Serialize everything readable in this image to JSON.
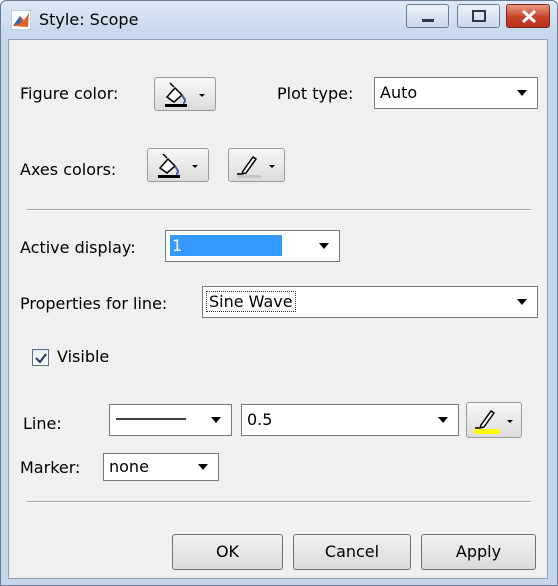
{
  "window": {
    "title": "Style: Scope",
    "colors": {
      "titlebar": "#c5d7ec",
      "close": "#c7412a",
      "selection": "#3399ff",
      "line_color": "#ffff00"
    }
  },
  "figure": {
    "color_label": "Figure color:",
    "plot_type_label": "Plot type:",
    "plot_type_value": "Auto"
  },
  "axes": {
    "colors_label": "Axes colors:"
  },
  "display": {
    "active_label": "Active display:",
    "active_value": "1",
    "properties_label": "Properties for line:",
    "properties_value": "Sine Wave"
  },
  "line": {
    "visible_label": "Visible",
    "visible_checked": true,
    "line_label": "Line:",
    "width_value": "0.5",
    "marker_label": "Marker:",
    "marker_value": "none"
  },
  "buttons": {
    "ok": "OK",
    "cancel": "Cancel",
    "apply": "Apply"
  },
  "icons": {
    "app": "matlab-icon",
    "fill": "paint-bucket-icon",
    "pen": "pen-icon",
    "dropdown": "chevron-down-icon"
  }
}
